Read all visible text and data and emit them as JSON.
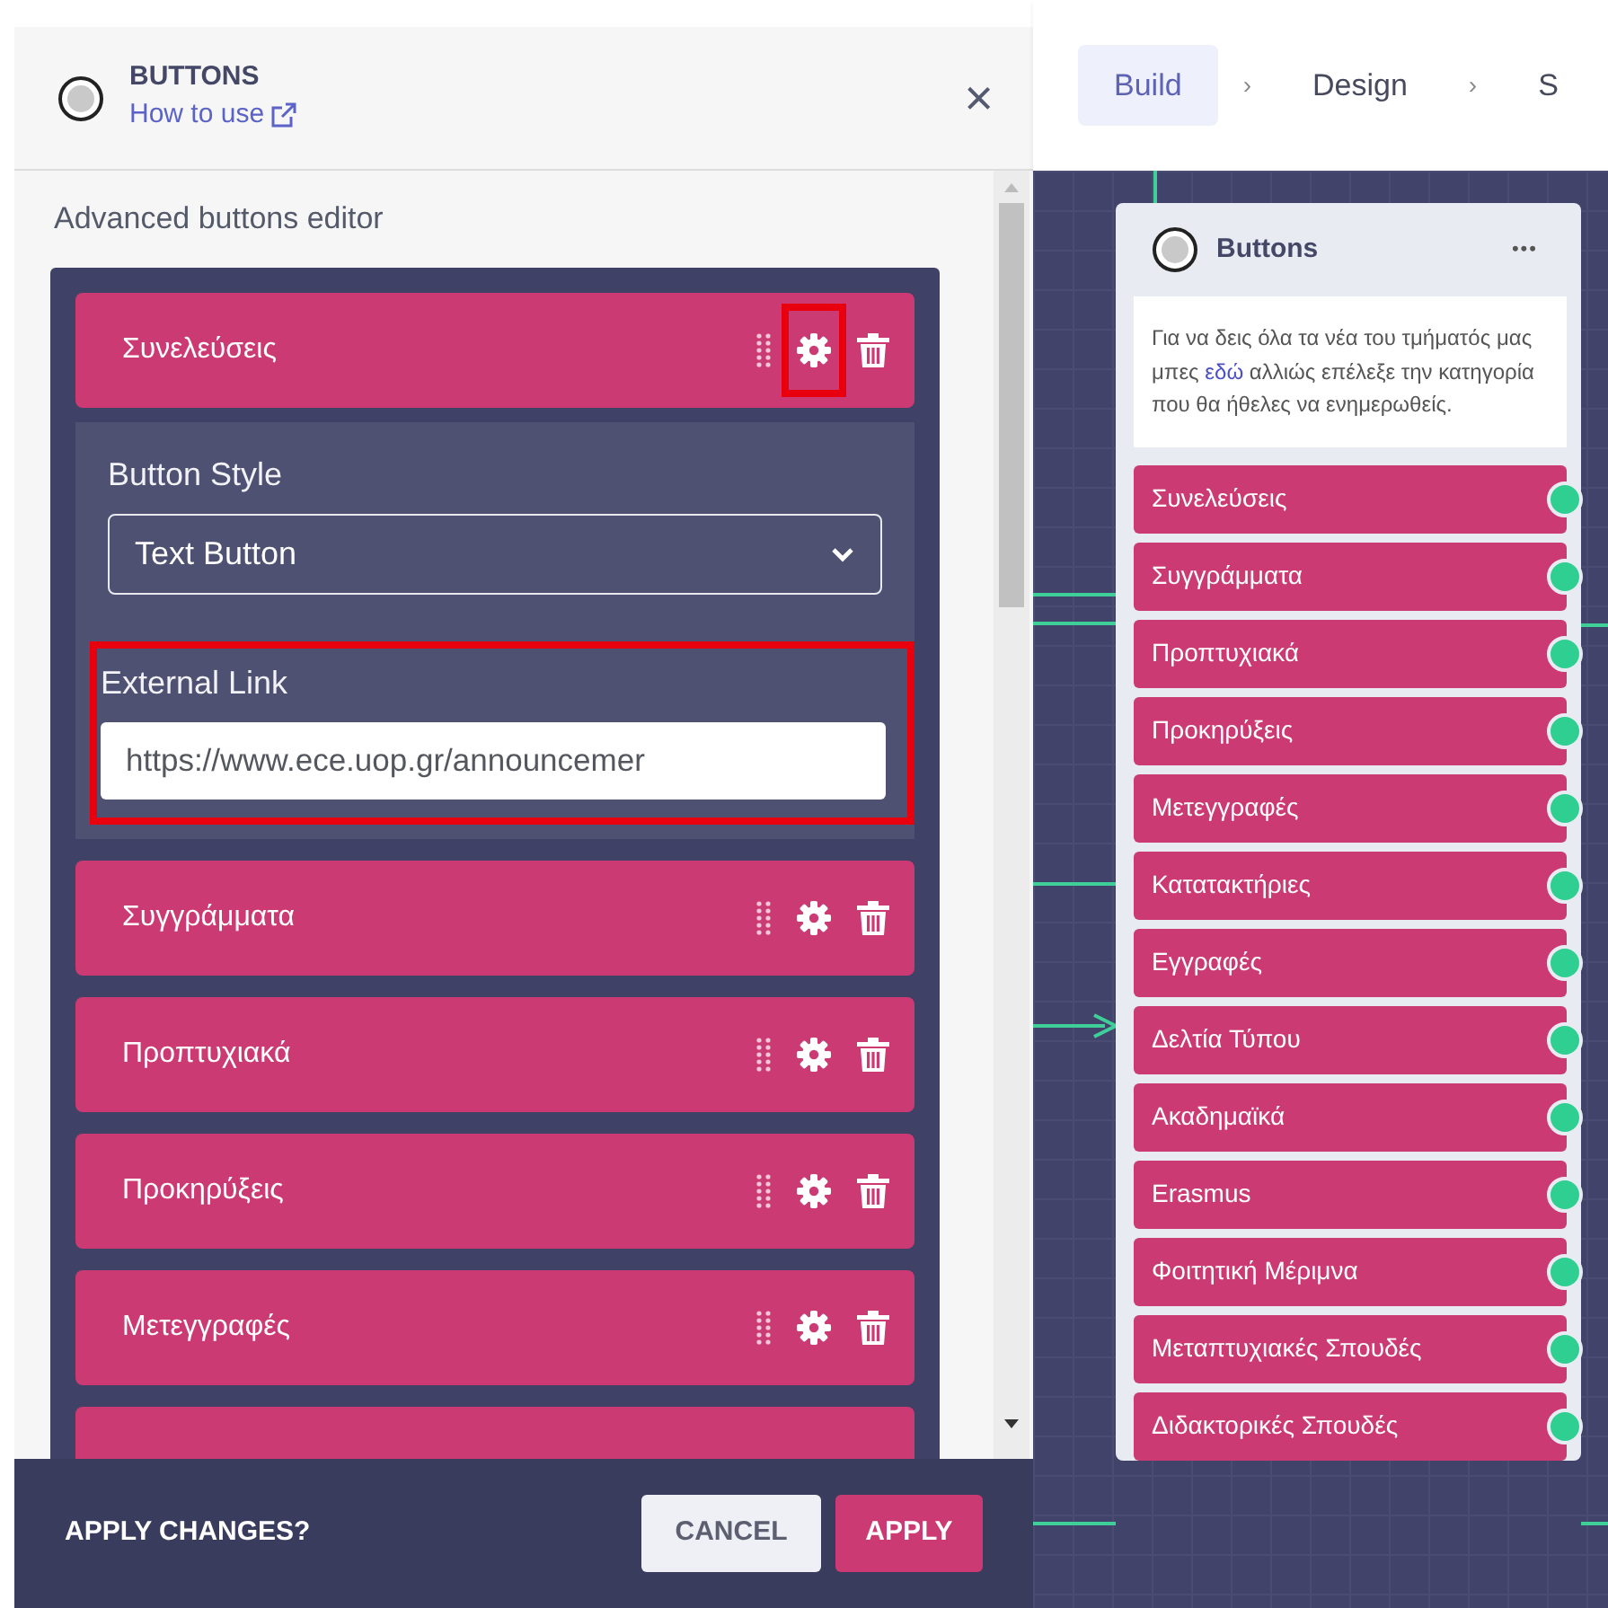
{
  "panel": {
    "title": "BUTTONS",
    "help_link": "How to use",
    "close": "×"
  },
  "editor": {
    "title": "Advanced buttons editor",
    "items": [
      {
        "label": "Συνελεύσεις",
        "expanded": true,
        "gear_highlighted": true
      },
      {
        "label": "Συγγράμματα",
        "expanded": false,
        "gear_highlighted": false
      },
      {
        "label": "Προπτυχιακά",
        "expanded": false,
        "gear_highlighted": false
      },
      {
        "label": "Προκηρύξεις",
        "expanded": false,
        "gear_highlighted": false
      },
      {
        "label": "Μετεγγραφές",
        "expanded": false,
        "gear_highlighted": false
      }
    ],
    "settings": {
      "style_label": "Button Style",
      "style_value": "Text Button",
      "link_label": "External Link",
      "link_value": "https://www.ece.uop.gr/announcemer",
      "link_highlighted": true
    }
  },
  "footer": {
    "prompt": "APPLY CHANGES?",
    "buttons": [
      {
        "label": "CANCEL",
        "kind": "secondary"
      },
      {
        "label": "APPLY",
        "kind": "primary"
      }
    ]
  },
  "steps": {
    "tabs": [
      {
        "label": "Build",
        "selected": true
      },
      {
        "label": "Design",
        "selected": false
      },
      {
        "label": "S",
        "selected": false
      }
    ],
    "separators": [
      "›",
      "›"
    ]
  },
  "node": {
    "title": "Buttons",
    "menu": "•••",
    "message": [
      {
        "text": "Για να δεις όλα τα νέα του τμήματός μας μπες "
      },
      {
        "text": "εδώ",
        "kind": "link"
      },
      {
        "text": " αλλιώς επέλεξε την κατηγορία που θα ήθελες να ενημερωθείς."
      }
    ],
    "buttons": [
      "Συνελεύσεις",
      "Συγγράμματα",
      "Προπτυχιακά",
      "Προκηρύξεις",
      "Μετεγγραφές",
      "Κατατακτήριες",
      "Εγγραφές",
      "Δελτία Τύπου",
      "Ακαδημαϊκά",
      "Erasmus",
      "Φοιτητική Μέριμνα",
      "Μεταπτυχιακές Σπουδές",
      "Διδακτορικές Σπουδές"
    ]
  }
}
